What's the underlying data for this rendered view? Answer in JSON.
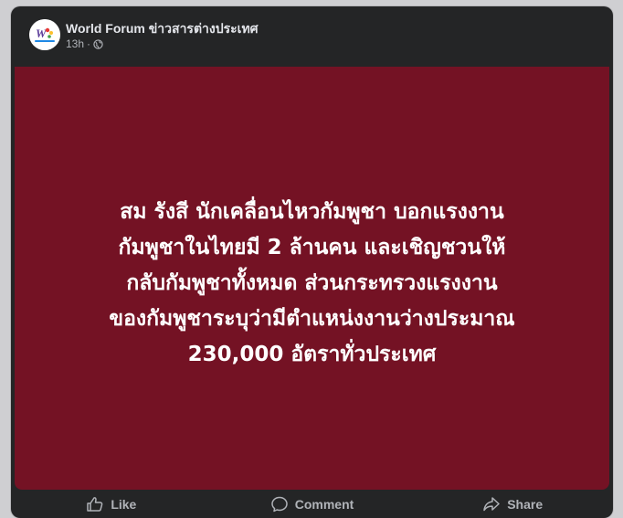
{
  "post": {
    "page_name": "World Forum ข่าวสารต่างประเทศ",
    "time": "13h",
    "separator": "·",
    "privacy_icon": "globe-icon",
    "avatar_logo_text": "WorldForum",
    "image": {
      "background_color": "#741224",
      "text_color": "#ffffff",
      "lines": [
        "สม รังสี นักเคลื่อนไหวกัมพูชา บอกแรงงาน",
        "กัมพูชาในไทยมี 2 ล้านคน และเชิญชวนให้",
        "กลับกัมพูชาทั้งหมด ส่วนกระทรวงแรงงาน",
        "ของกัมพูชาระบุว่ามีตำแหน่งงานว่างประมาณ",
        "230,000 อัตราทั่วประเทศ"
      ]
    }
  },
  "actions": {
    "like": {
      "label": "Like",
      "icon": "thumbs-up-icon"
    },
    "comment": {
      "label": "Comment",
      "icon": "comment-icon"
    },
    "share": {
      "label": "Share",
      "icon": "share-icon"
    }
  }
}
